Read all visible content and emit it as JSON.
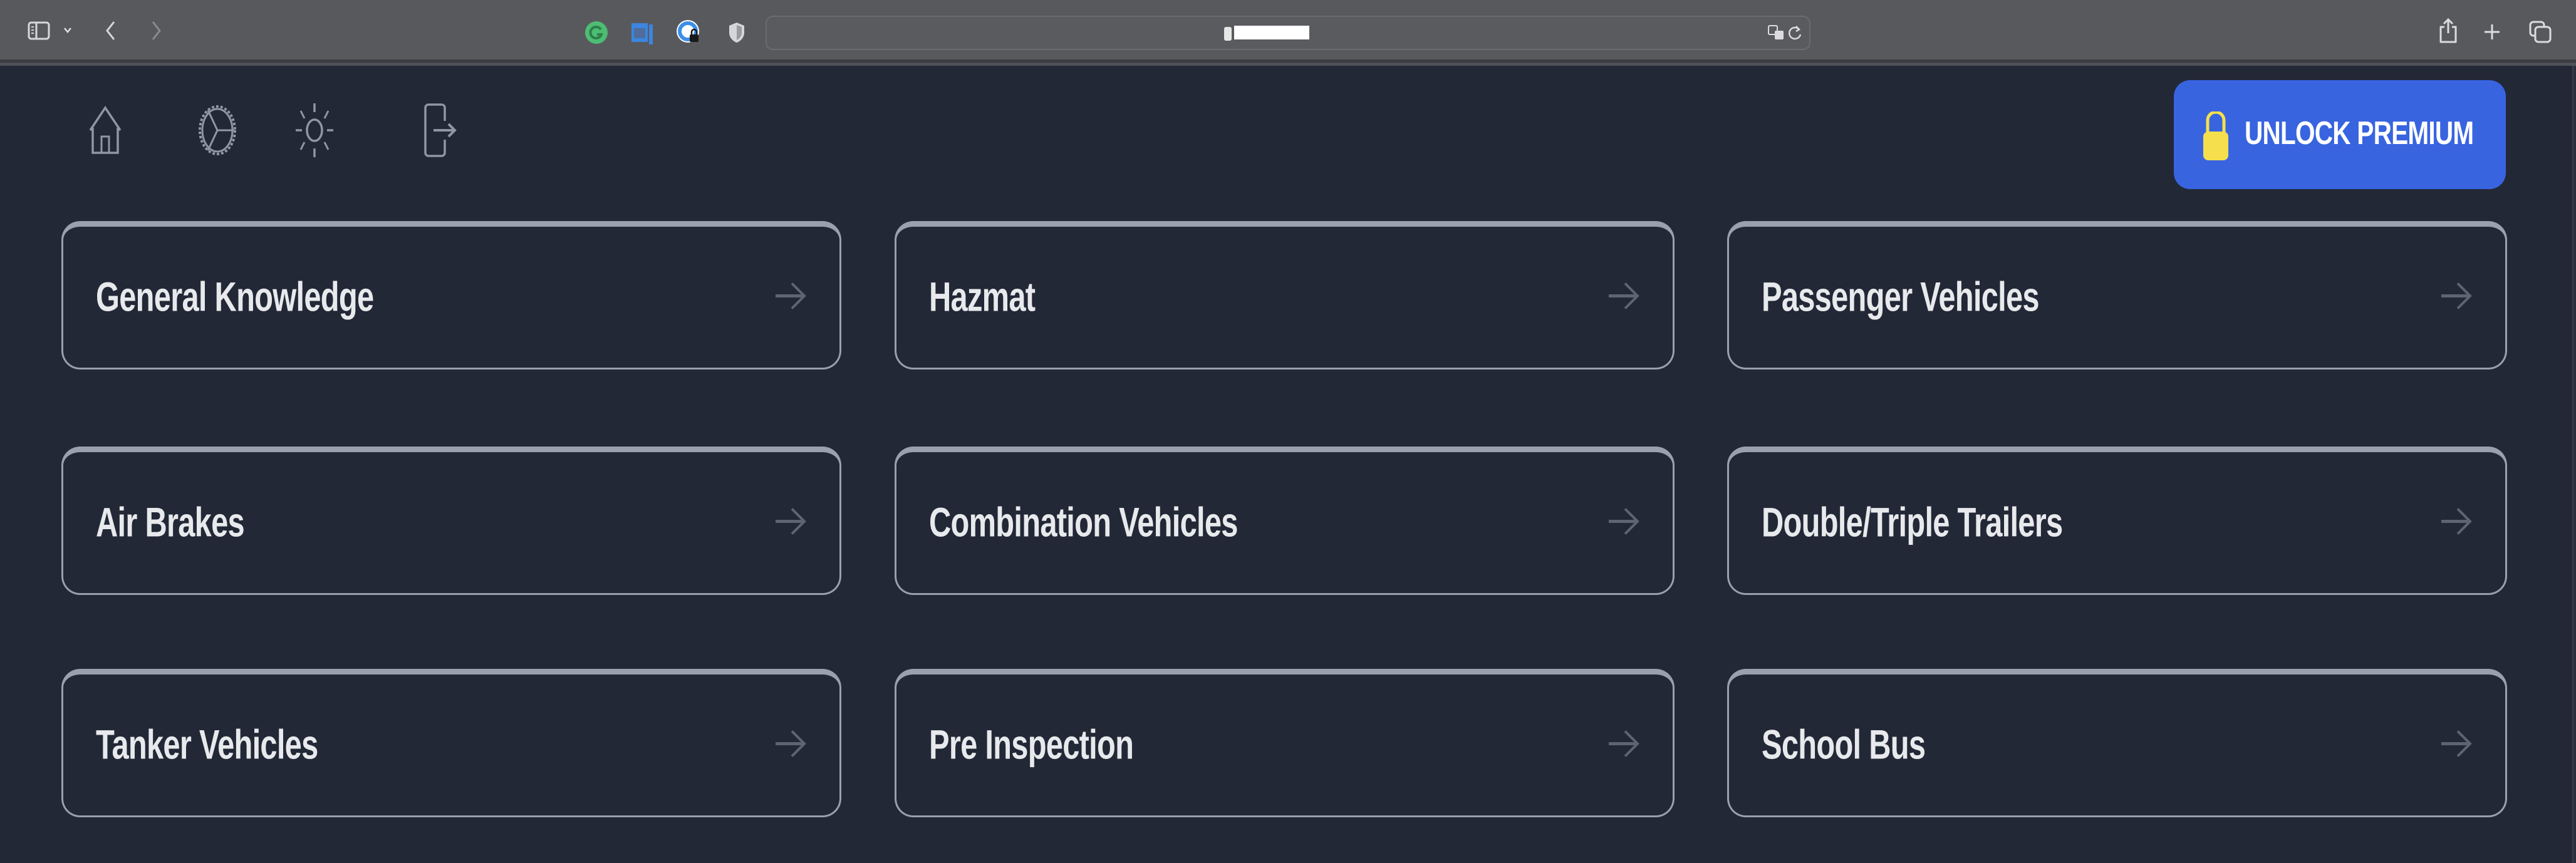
{
  "browser": {
    "url": "redacted",
    "toolbar_icons": [
      "sidebar-toggle",
      "chevron-down",
      "back",
      "forward",
      "grammarly-extension",
      "reader-extension",
      "password-manager-extension",
      "privacy-shield"
    ],
    "right_icons": [
      "share",
      "new-tab",
      "tab-overview"
    ]
  },
  "header": {
    "nav_icons": [
      {
        "name": "home",
        "label": "Home"
      },
      {
        "name": "steering-wheel",
        "label": "Settings"
      },
      {
        "name": "sun",
        "label": "Toggle theme"
      },
      {
        "name": "logout",
        "label": "Log out"
      }
    ],
    "premium_button": {
      "label": "UNLOCK PREMIUM",
      "icon": "lock",
      "bg_color": "#3864e0",
      "icon_color": "#f5df4d"
    }
  },
  "categories": [
    {
      "label": "General Knowledge"
    },
    {
      "label": "Hazmat"
    },
    {
      "label": "Passenger Vehicles"
    },
    {
      "label": "Air Brakes"
    },
    {
      "label": "Combination Vehicles"
    },
    {
      "label": "Double/Triple Trailers"
    },
    {
      "label": "Tanker Vehicles"
    },
    {
      "label": "Pre Inspection"
    },
    {
      "label": "School Bus"
    }
  ],
  "theme": {
    "background": "#222836",
    "card_border": "#9aa0ac",
    "card_text": "#e8e9ec",
    "arrow": "#5f6473"
  }
}
